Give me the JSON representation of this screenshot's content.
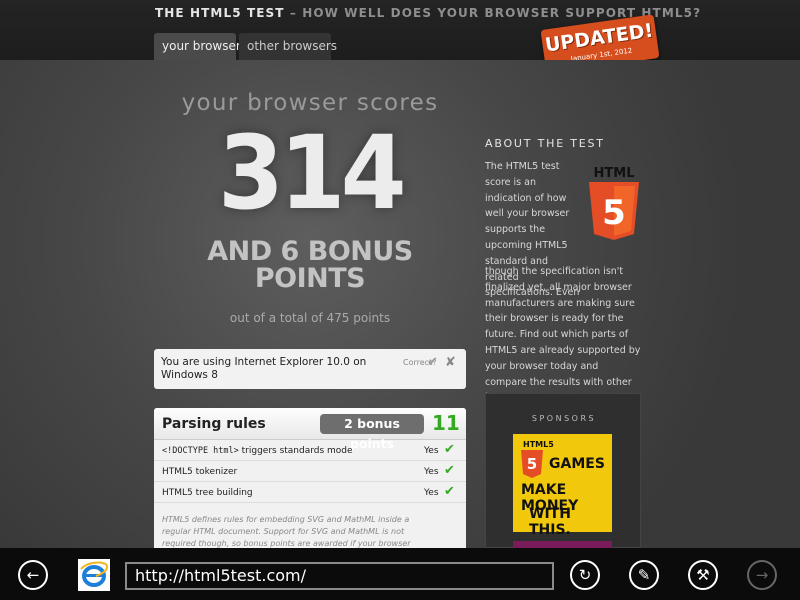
{
  "header": {
    "title_main": "THE HTML5 TEST",
    "title_sub": " – HOW WELL DOES YOUR BROWSER SUPPORT HTML5?",
    "tabs": [
      {
        "label": "your browser",
        "active": true
      },
      {
        "label": "other browsers",
        "active": false
      }
    ],
    "badge": {
      "main": "UPDATED!",
      "sub": "January 1st, 2012"
    }
  },
  "score": {
    "heading": "your browser scores",
    "value": "314",
    "bonus": "AND 6 BONUS POINTS",
    "total": "out of a total of 475 points"
  },
  "browser_info": {
    "text": "You are using Internet Explorer 10.0 on Windows 8",
    "correct_label": "Correct?"
  },
  "parsing": {
    "title": "Parsing rules",
    "bonus": "2 bonus points",
    "score": "11",
    "rows": [
      {
        "code": "<!DOCTYPE html>",
        "label": " triggers standards mode",
        "result": "Yes"
      },
      {
        "code": "",
        "label": "HTML5 tokenizer",
        "result": "Yes"
      },
      {
        "code": "",
        "label": "HTML5 tree building",
        "result": "Yes"
      }
    ],
    "note": "HTML5 defines rules for embedding SVG and MathML inside a regular HTML document. Support for SVG and MathML is not required though, so bonus points are awarded if your browser"
  },
  "about": {
    "title": "ABOUT THE TEST",
    "text_a": "The HTML5 test score is an indication of how well your browser supports the upcoming HTML5 standard and related specifications. Even",
    "text_b": "though the specification isn't finalized yet, all major browser manufacturers are making sure their browser is ready for the future. Find out which parts of HTML5 are already supported by your browser today and compare the results with other browsers.",
    "logo_text": "HTML",
    "logo_digit": "5"
  },
  "sponsors": {
    "title": "SPONSORS",
    "ad": {
      "brand": "HTML5",
      "line1": "GAMES",
      "line2": "MAKE MONEY",
      "line3": "WITH THIS."
    }
  },
  "appbar": {
    "url": "http://html5test.com/"
  },
  "colors": {
    "badge": "#d64e1d",
    "score_green": "#33aa22",
    "html5_orange": "#e44d26",
    "ad_yellow": "#f2c80c"
  }
}
